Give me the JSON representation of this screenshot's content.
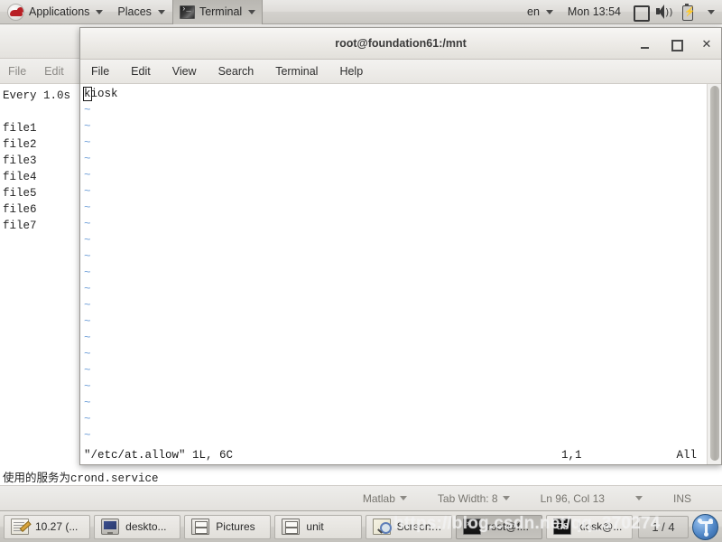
{
  "top_panel": {
    "logo_icon": "redhat-logo-icon",
    "applications_label": "Applications",
    "places_label": "Places",
    "terminal_label": "Terminal",
    "terminal_icon": "terminal-icon",
    "keyboard_layout": "en",
    "clock": "Mon 13:54",
    "display_icon": "display-icon",
    "speaker_icon": "speaker-icon",
    "battery_icon": "battery-charging-icon",
    "menu_caret_icon": "chevron-down-icon"
  },
  "gedit_window": {
    "menu": {
      "file": "File",
      "edit": "Edit"
    },
    "lines": [
      "Every 1.0s",
      "",
      "file1",
      "file2",
      "file3",
      "file4",
      "file5",
      "file6",
      "file7"
    ],
    "below_text_cjk": "使用的服务为",
    "below_text_mono": "crond.service",
    "statusbar": {
      "language": "Matlab",
      "tab_width": "Tab Width: 8",
      "position": "Ln 96, Col 13",
      "insert_mode": "INS"
    }
  },
  "terminal_window": {
    "title": "root@foundation61:/mnt",
    "window_buttons": {
      "minimize": "minimize-icon",
      "maximize": "maximize-icon",
      "close": "✕"
    },
    "menu": [
      "File",
      "Edit",
      "View",
      "Search",
      "Terminal",
      "Help"
    ],
    "vim": {
      "first_line_cursor_char": "k",
      "first_line_rest": "iosk",
      "tilde": "~",
      "tilde_rows": 21,
      "statusline_file": "\"/etc/at.allow\" 1L, 6C",
      "statusline_position": "1,1",
      "statusline_scroll": "All"
    }
  },
  "taskbar": {
    "items": [
      {
        "label": "10.27 (...",
        "icon": "gedit-icon",
        "active": false
      },
      {
        "label": "deskto...",
        "icon": "monitor-icon",
        "active": false
      },
      {
        "label": "Pictures",
        "icon": "file-manager-icon",
        "active": false
      },
      {
        "label": "unit",
        "icon": "file-manager-icon",
        "active": false
      },
      {
        "label": "Screens...",
        "icon": "screenshot-icon",
        "active": false
      },
      {
        "label": "root@f...",
        "icon": "terminal-icon",
        "active": true
      },
      {
        "label": "kiosk@...",
        "icon": "gs-icon",
        "active": false
      }
    ],
    "workspace_indicator": "1 / 4",
    "network_icon": "network-icon"
  },
  "watermark": {
    "text": "https://blog.csdn.net/qq_370274"
  },
  "colors": {
    "panel_bg": "#dedcd8",
    "tilde_blue": "#6f9fd8",
    "accent_red": "#b81f24",
    "network_blue": "#4f86c6"
  }
}
